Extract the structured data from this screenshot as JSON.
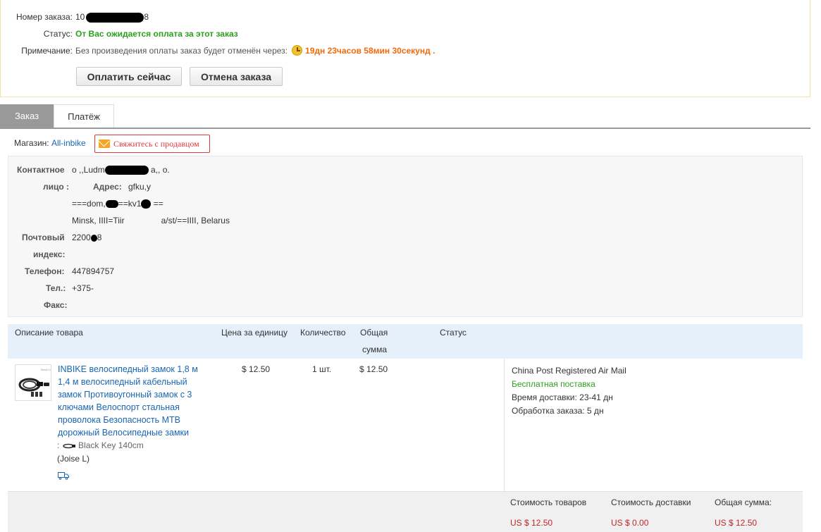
{
  "order": {
    "number_label": "Номер заказа:",
    "number_value_prefix": "10",
    "number_value_suffix": "8",
    "status_label": "Статус:",
    "status_value": "От Вас ожидается оплата за этот заказ",
    "remark_label": "Примечание:",
    "remark_text": "Без произведения оплаты заказ будет отменён через:",
    "countdown": "19дн 23часов 58мин 30секунд",
    "countdown_suffix": ".",
    "pay_button": "Оплатить сейчас",
    "cancel_button": "Отмена заказа"
  },
  "tabs": [
    {
      "label": "Заказ",
      "active": true
    },
    {
      "label": "Платёж",
      "active": false
    }
  ],
  "shop": {
    "label": "Магазин:",
    "name": "All-inbike",
    "contact_button": "Свяжитесь с продавцом"
  },
  "address": {
    "contact_label_1": "Контактное",
    "contact_label_2": "лицо :",
    "contact_value_prefix": "о ,,Ludm",
    "contact_value_suffix": "a,, o.",
    "address_label": "Адрес:",
    "address_line1": "gfku,y",
    "address_line2_a": "===dom,",
    "address_line2_b": "==kv1",
    "address_line2_c": "==",
    "address_line3_a": "Minsk, IIII=Tiir",
    "address_line3_b": "a/st/==IIII, Belarus",
    "postal_label_1": "Почтовый",
    "postal_label_2": "индекс:",
    "postal_value_prefix": "2200",
    "postal_value_suffix": "8",
    "phone_label": "Телефон:",
    "phone_value": "447894757",
    "tel_label": "Тел.:",
    "tel_value": "+375-",
    "fax_label": "Факс:"
  },
  "table": {
    "headers": {
      "description": "Описание товара",
      "unit_price": "Цена за единицу",
      "quantity": "Количество",
      "total_1": "Общая",
      "total_2": "сумма",
      "status": "Статус"
    },
    "item": {
      "title": "INBIKE велосипедный замок 1,8 м 1,4 м велосипедный кабельный замок Противоугонный замок с 3 ключами Велоспорт стальная проволока Безопасность MTB дорожный Велосипедные замки",
      "sku_prefix": ":",
      "sku_color": "Black Key 140cm",
      "sku_extra": "(Joise L)",
      "unit_price": "$ 12.50",
      "quantity": "1 шт.",
      "total": "$ 12.50",
      "shipping_method": "China Post Registered Air Mail",
      "shipping_free": "Бесплатная поставка",
      "delivery_time": "Время доставки:  23-41 дн",
      "processing_time": "Обработка заказа:  5 дн"
    }
  },
  "summary": {
    "goods_label": "Стоимость товаров",
    "goods_value": "US $ 12.50",
    "shipping_label": "Стоимость доставки",
    "shipping_value": "US $ 0.00",
    "total_label": "Общая сумма:",
    "total_value": "US $ 12.50"
  },
  "colors": {
    "status_green": "#2d9f1f",
    "countdown_orange": "#f06a0d",
    "link_blue": "#1a66b3",
    "price_red": "#c0262d",
    "header_bg": "#e5f0fb"
  }
}
